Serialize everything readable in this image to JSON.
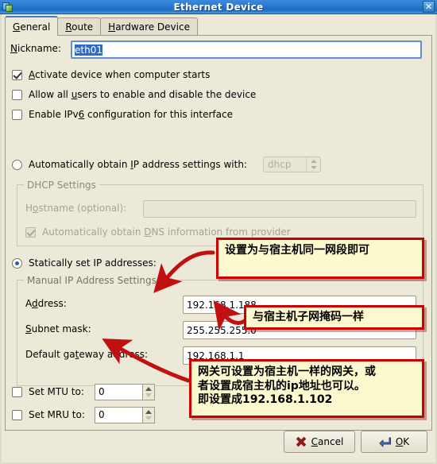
{
  "window": {
    "title": "Ethernet Device",
    "icon": "network-device-icon",
    "close_label": "✕"
  },
  "tabs": [
    {
      "label": "General",
      "accel": "G",
      "active": true
    },
    {
      "label": "Route",
      "accel": "R",
      "active": false
    },
    {
      "label": "Hardware Device",
      "accel": "H",
      "active": false
    }
  ],
  "general": {
    "nickname_label": "Nickname:",
    "nickname_accel": "N",
    "nickname_value": "eth01",
    "checkboxes": [
      {
        "label_pre": "",
        "accel": "A",
        "label_post": "ctivate device when computer starts",
        "checked": true,
        "enabled": true
      },
      {
        "label_pre": "Allow all ",
        "accel": "u",
        "label_post": "sers to enable and disable the device",
        "checked": false,
        "enabled": true
      },
      {
        "label_pre": "Enable IPv",
        "accel": "6",
        "label_post": " configuration for this interface",
        "checked": false,
        "enabled": true
      }
    ],
    "auto_radio": {
      "label_pre": "Automatically obtain ",
      "accel": "I",
      "label_post": "P address settings with:",
      "selected": false
    },
    "dhcp_combo_value": "dhcp",
    "dhcp_group_title": "DHCP Settings",
    "hostname_label": "H​ostname (optional):",
    "hostname_label_pre": "H",
    "hostname_accel": "o",
    "hostname_label_post": "stname (optional):",
    "hostname_value": "",
    "dns_checkbox": {
      "label_pre": "Automatically obtain ",
      "accel": "D",
      "label_post": "NS information from provider",
      "checked": true
    },
    "static_radio": {
      "label": "Statically set IP addresses:",
      "selected": true
    },
    "manual_group_title": "Manual IP Address Settings",
    "fields": [
      {
        "label_pre": "A",
        "accel": "d",
        "label_post": "dress:",
        "value": "192.168.1.188",
        "name": "address"
      },
      {
        "label_pre": "",
        "accel": "S",
        "label_post": "ubnet mask:",
        "value": "255.255.255.0",
        "name": "subnet-mask"
      },
      {
        "label_pre": "Default ga",
        "accel": "t",
        "label_post": "eway address:",
        "value": "192.168.1.1",
        "name": "default-gateway"
      }
    ],
    "mtu": {
      "label": "Set MTU to:",
      "value": "0",
      "checked": false
    },
    "mru": {
      "label": "Set MRU to:",
      "value": "0",
      "checked": false
    }
  },
  "buttons": {
    "cancel": {
      "label_pre": "",
      "accel": "C",
      "label_post": "ancel",
      "icon": "x-icon"
    },
    "ok": {
      "label_pre": "",
      "accel": "O",
      "label_post": "K",
      "icon": "enter-arrow-icon"
    }
  },
  "annotations": [
    {
      "id": "annotation-address",
      "lines": [
        "设置为与宿主机同一网段即可"
      ]
    },
    {
      "id": "annotation-subnet",
      "lines": [
        "与宿主机子网掩码一样"
      ]
    },
    {
      "id": "annotation-gateway",
      "lines": [
        "网关可设置为宿主机一样的网关，或",
        "者设置成宿主机的ip地址也可以。",
        "即设置成192.168.1.102"
      ]
    }
  ],
  "colors": {
    "titlebar": "#2b7bd0",
    "dialog_bg": "#ece9d8",
    "callout_bg": "#fdf9cf",
    "callout_border": "#cc0000",
    "selection": "#316ac5",
    "accent": "#2a5fb0"
  }
}
